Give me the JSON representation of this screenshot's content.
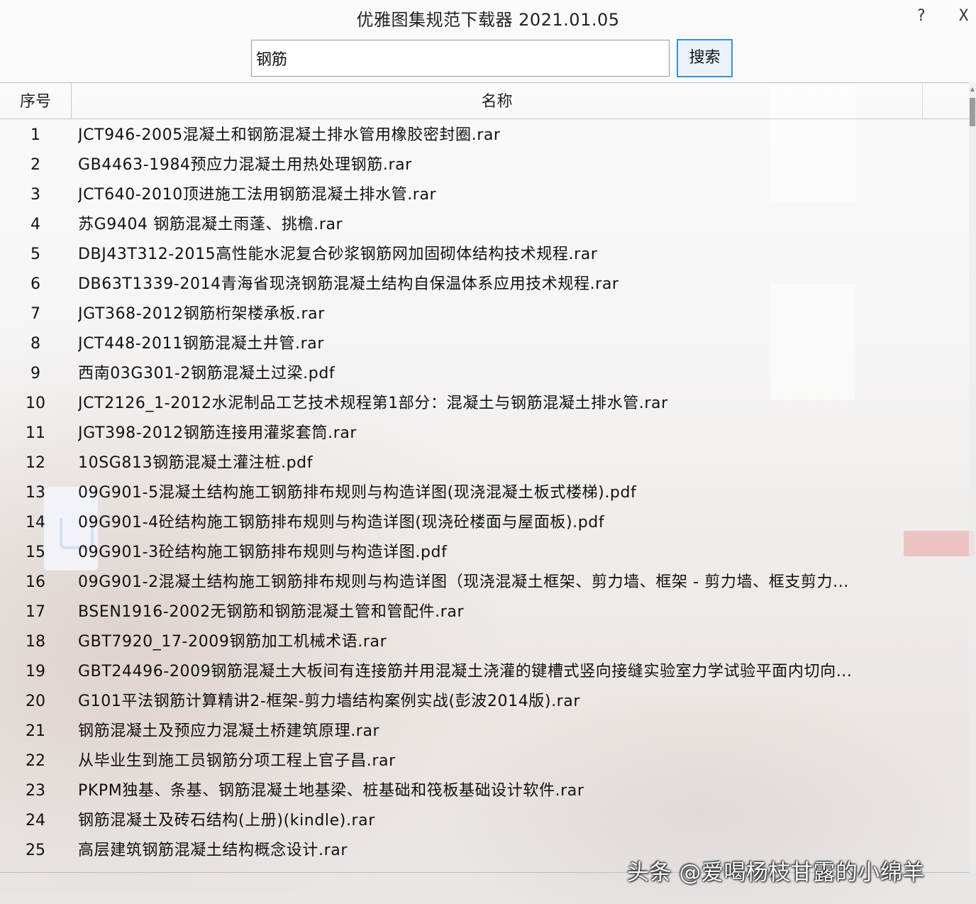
{
  "window": {
    "title": "优雅图集规范下载器 2021.01.05",
    "help_label": "?",
    "close_label": "X"
  },
  "search": {
    "value": "钢筋",
    "button_label": "搜索"
  },
  "table": {
    "columns": [
      "序号",
      "名称"
    ],
    "rows": [
      {
        "num": "1",
        "name": "JCT946-2005混凝土和钢筋混凝土排水管用橡胶密封圈.rar"
      },
      {
        "num": "2",
        "name": "GB4463-1984预应力混凝土用热处理钢筋.rar"
      },
      {
        "num": "3",
        "name": "JCT640-2010顶进施工法用钢筋混凝土排水管.rar"
      },
      {
        "num": "4",
        "name": "苏G9404 钢筋混凝土雨蓬、挑檐.rar"
      },
      {
        "num": "5",
        "name": "DBJ43T312-2015高性能水泥复合砂浆钢筋网加固砌体结构技术规程.rar"
      },
      {
        "num": "6",
        "name": "DB63T1339-2014青海省现浇钢筋混凝土结构自保温体系应用技术规程.rar"
      },
      {
        "num": "7",
        "name": "JGT368-2012钢筋桁架楼承板.rar"
      },
      {
        "num": "8",
        "name": "JCT448-2011钢筋混凝土井管.rar"
      },
      {
        "num": "9",
        "name": "西南03G301-2钢筋混凝土过梁.pdf"
      },
      {
        "num": "10",
        "name": "JCT2126_1-2012水泥制品工艺技术规程第1部分：混凝土与钢筋混凝土排水管.rar"
      },
      {
        "num": "11",
        "name": "JGT398-2012钢筋连接用灌浆套筒.rar"
      },
      {
        "num": "12",
        "name": "10SG813钢筋混凝土灌注桩.pdf"
      },
      {
        "num": "13",
        "name": "09G901-5混凝土结构施工钢筋排布规则与构造详图(现浇混凝土板式楼梯).pdf"
      },
      {
        "num": "14",
        "name": "09G901-4砼结构施工钢筋排布规则与构造详图(现浇砼楼面与屋面板).pdf"
      },
      {
        "num": "15",
        "name": "09G901-3砼结构施工钢筋排布规则与构造详图.pdf"
      },
      {
        "num": "16",
        "name": "09G901-2混凝土结构施工钢筋排布规则与构造详图（现浇混凝土框架、剪力墙、框架 - 剪力墙、框支剪力..."
      },
      {
        "num": "17",
        "name": "BSEN1916-2002无钢筋和钢筋混凝土管和管配件.rar"
      },
      {
        "num": "18",
        "name": "GBT7920_17-2009钢筋加工机械术语.rar"
      },
      {
        "num": "19",
        "name": "GBT24496-2009钢筋混凝土大板间有连接筋并用混凝土浇灌的键槽式竖向接缝实验室力学试验平面内切向..."
      },
      {
        "num": "20",
        "name": "G101平法钢筋计算精讲2-框架-剪力墙结构案例实战(彭波2014版).rar"
      },
      {
        "num": "21",
        "name": "钢筋混凝土及预应力混凝土桥建筑原理.rar"
      },
      {
        "num": "22",
        "name": "从毕业生到施工员钢筋分项工程上官子昌.rar"
      },
      {
        "num": "23",
        "name": "PKPM独基、条基、钢筋混凝土地基梁、桩基础和筏板基础设计软件.rar"
      },
      {
        "num": "24",
        "name": "钢筋混凝土及砖石结构(上册)(kindle).rar"
      },
      {
        "num": "25",
        "name": "高层建筑钢筋混凝土结构概念设计.rar"
      }
    ]
  },
  "watermark": "头条 @爱喝杨枝甘露的小绵羊",
  "colors": {
    "accent": "#3b8de0",
    "button_bg": "#eaf3fc",
    "grid_line": "#c8c8c8"
  }
}
